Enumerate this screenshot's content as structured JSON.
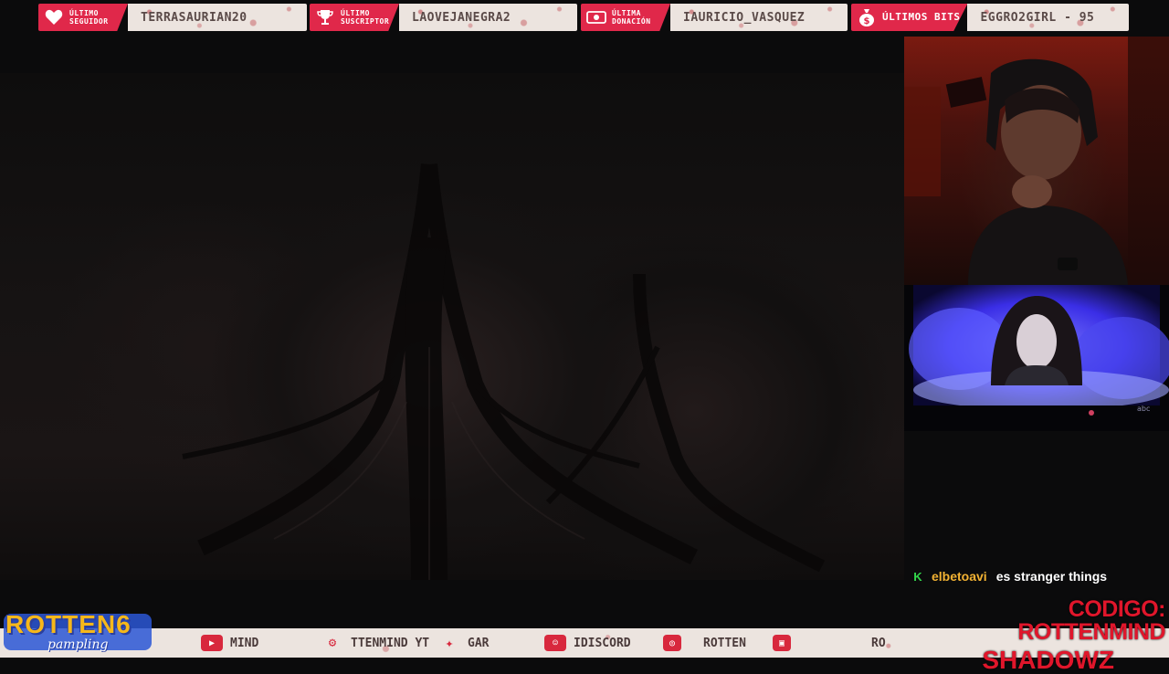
{
  "alerts": [
    {
      "label": "ÚLTIMO SEGUIDOR",
      "icon": "heart-icon",
      "value": "TERRASAURIAN20"
    },
    {
      "label": "ÚLTIMO SUSCRIPTOR",
      "icon": "trophy-icon",
      "value": "LAOVEJANEGRA2"
    },
    {
      "label": "ÚLTIMA DONACIÓN",
      "icon": "cash-icon",
      "value": "IAURICIO_VASQUEZ"
    },
    {
      "label": "ÚLTIMOS BITS",
      "icon": "moneybag-icon",
      "value": "EGGRO2GIRL - 95"
    }
  ],
  "chat": {
    "badge": "K",
    "username": "elbetoavi",
    "message": "es stranger things"
  },
  "promo": {
    "line1": "CODIGO: ROTTENMIND",
    "line2": "SHADOWZ"
  },
  "logo": {
    "word": "ROTTEN6",
    "sub": "pampling"
  },
  "ticker": [
    {
      "icon": "youtube-icon",
      "text": "MIND"
    },
    {
      "icon": "steam-icon",
      "text": "TTENMIND YT"
    },
    {
      "icon": "twitter-icon",
      "text": "GAR"
    },
    {
      "icon": "discord-icon",
      "text": "IDISCORD"
    },
    {
      "icon": "instagram-icon",
      "text": "ROTTEN"
    },
    {
      "icon": "twitch-icon",
      "text": "RO"
    }
  ],
  "colors": {
    "alert_red": "#e0284a",
    "promo_red": "#e0162b",
    "chat_user": "#f2b233",
    "chat_badge": "#32d74b",
    "logo_yellow": "#f6b81a"
  }
}
